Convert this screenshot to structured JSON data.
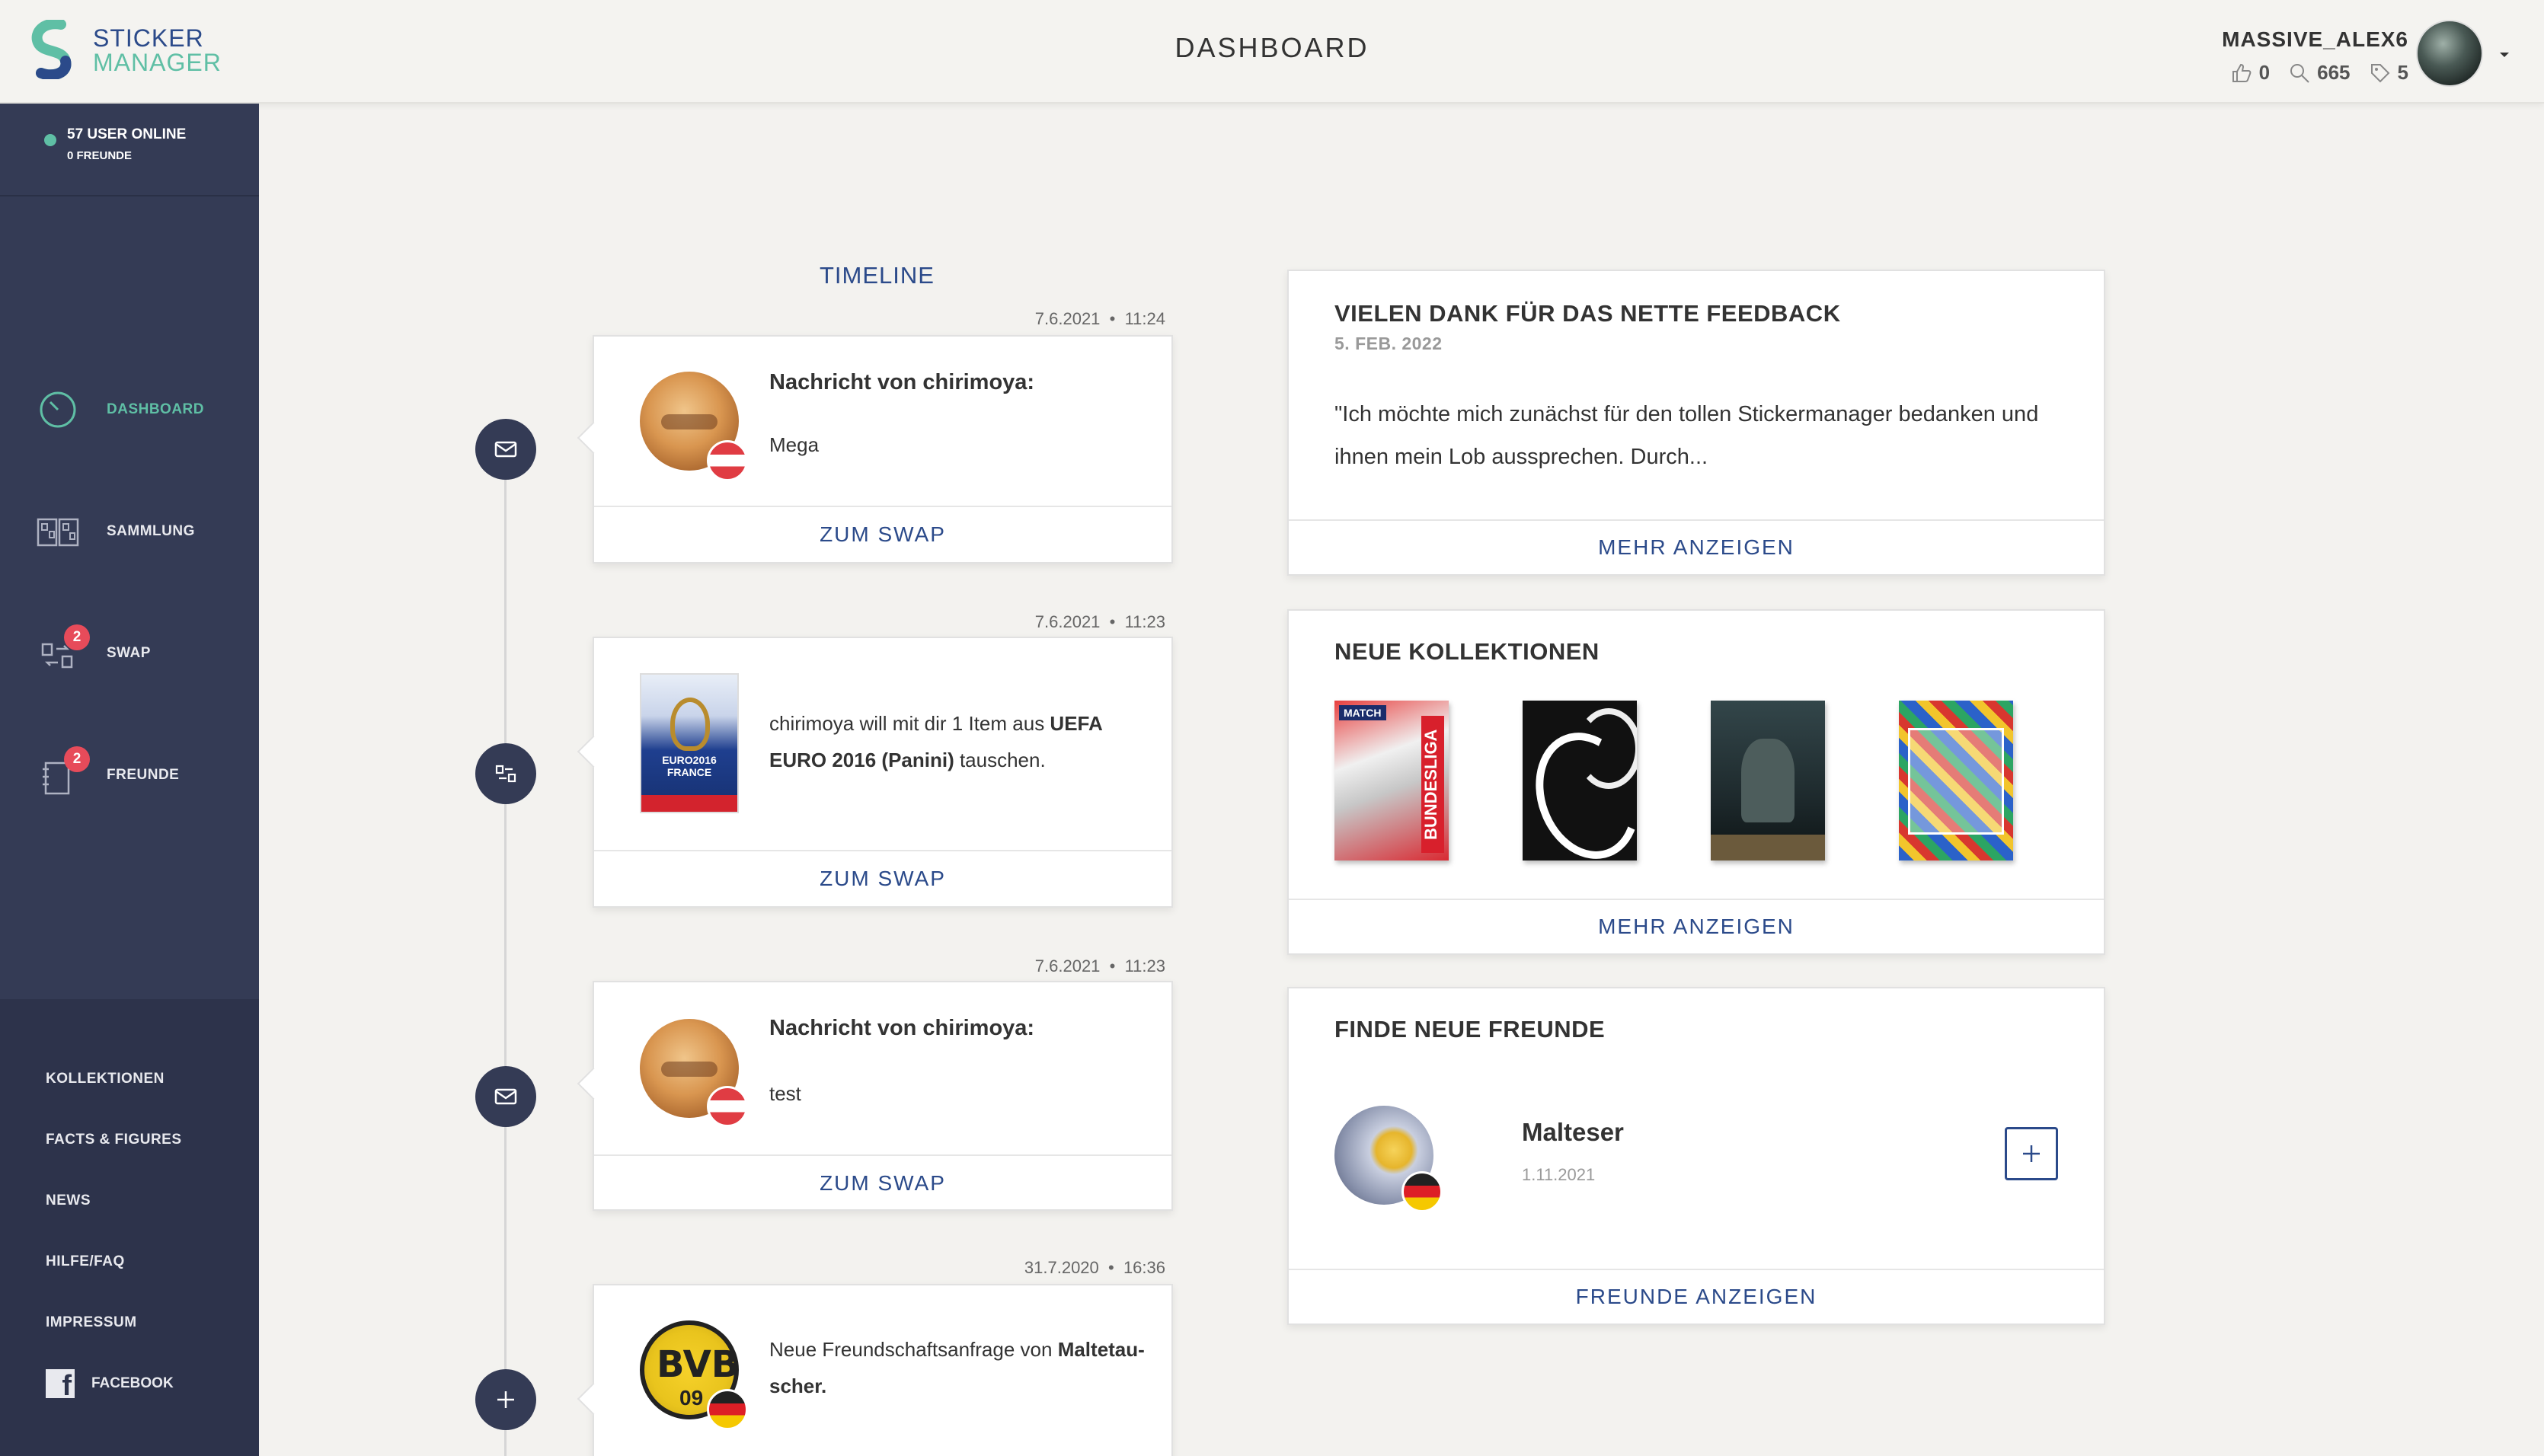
{
  "app": {
    "logo_line1": "STICKER",
    "logo_line2": "MANAGER",
    "page_title": "DASHBOARD"
  },
  "user": {
    "name": "MASSIVE_ALEX6",
    "likes": "0",
    "searches": "665",
    "tags": "5"
  },
  "sidebar": {
    "online_count": "57 USER ONLINE",
    "friends_count": "0 FREUNDE",
    "nav": [
      {
        "label": "DASHBOARD",
        "icon": "dashboard-gauge-icon",
        "active": true
      },
      {
        "label": "SAMMLUNG",
        "icon": "album-icon"
      },
      {
        "label": "SWAP",
        "icon": "swap-icon",
        "badge": "2"
      },
      {
        "label": "FREUNDE",
        "icon": "friends-book-icon",
        "badge": "2"
      }
    ],
    "footer_links": [
      "KOLLEKTIONEN",
      "FACTS & FIGURES",
      "NEWS",
      "HILFE/FAQ",
      "IMPRESSUM"
    ],
    "facebook_label": "FACEBOOK"
  },
  "timeline": {
    "title": "TIMELINE",
    "items": [
      {
        "date": "7.6.2021",
        "time": "11:24",
        "type": "message",
        "title": "Nachricht von chirimoya:",
        "text": "Mega",
        "action": "ZUM SWAP",
        "flag": "at"
      },
      {
        "date": "7.6.2021",
        "time": "11:23",
        "type": "swap",
        "text_prefix": "chirimoya will mit dir 1 Item aus ",
        "text_bold": "UEFA EURO 2016 (Panini)",
        "text_suffix": " tauschen.",
        "sticker_label": "EURO2016 FRANCE",
        "action": "ZUM SWAP"
      },
      {
        "date": "7.6.2021",
        "time": "11:23",
        "type": "message",
        "title": "Nachricht von chirimoya:",
        "text": "test",
        "action": "ZUM SWAP",
        "flag": "at"
      },
      {
        "date": "31.7.2020",
        "time": "16:36",
        "type": "friend",
        "text_prefix": "Neue Freundschaftsanfrage von ",
        "text_bold": "Maltetau-scher.",
        "flag": "de",
        "logo_text": "BVB",
        "logo_num": "09"
      }
    ]
  },
  "feedback": {
    "title": "VIELEN DANK FÜR DAS NETTE FEEDBACK",
    "date": "5. FEB. 2022",
    "quote": "\"Ich möchte mich zunächst für den tollen Stickermanager bedanken und ihnen mein Lob aussprechen. Durch...",
    "more": "MEHR ANZEIGEN"
  },
  "collections": {
    "title": "NEUE KOLLEKTIONEN",
    "cover1_top": "MATCH",
    "cover1_side": "BUNDESLIGA",
    "more": "MEHR ANZEIGEN"
  },
  "friends_panel": {
    "title": "FINDE NEUE FREUNDE",
    "friend_name": "Malteser",
    "friend_date": "1.11.2021",
    "show_all": "FREUNDE ANZEIGEN"
  },
  "colors": {
    "sidebar": "#343b55",
    "accent_blue": "#2b4a8a",
    "accent_green": "#5fbfa5",
    "badge_red": "#e74b5a"
  }
}
